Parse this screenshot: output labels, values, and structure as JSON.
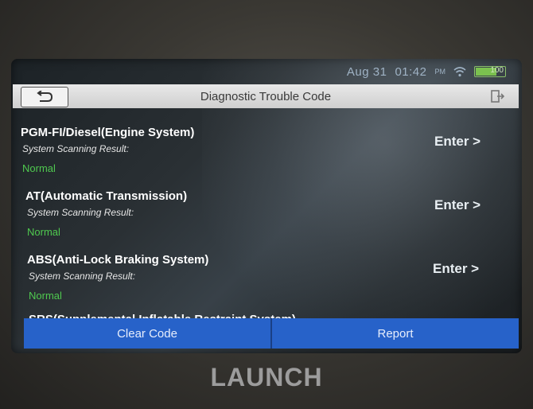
{
  "status": {
    "date": "Aug 31",
    "time": "01:42",
    "ampm": "PM",
    "battery": "100"
  },
  "header": {
    "title": "Diagnostic Trouble Code"
  },
  "systems": [
    {
      "name": "PGM-FI/Diesel(Engine System)",
      "label": "System Scanning Result:",
      "status": "Normal",
      "action": "Enter >"
    },
    {
      "name": "AT(Automatic Transmission)",
      "label": "System Scanning Result:",
      "status": "Normal",
      "action": "Enter >"
    },
    {
      "name": "ABS(Anti-Lock Braking System)",
      "label": "System Scanning Result:",
      "status": "Normal",
      "action": "Enter >"
    }
  ],
  "partial_item": "SRS(Supplemental Inflatable Restraint System)",
  "footer": {
    "clear_code": "Clear Code",
    "report": "Report"
  },
  "device": {
    "logo": "LAUNCH"
  },
  "colors": {
    "accent": "#2762c9",
    "status_normal": "#4fc94f"
  }
}
